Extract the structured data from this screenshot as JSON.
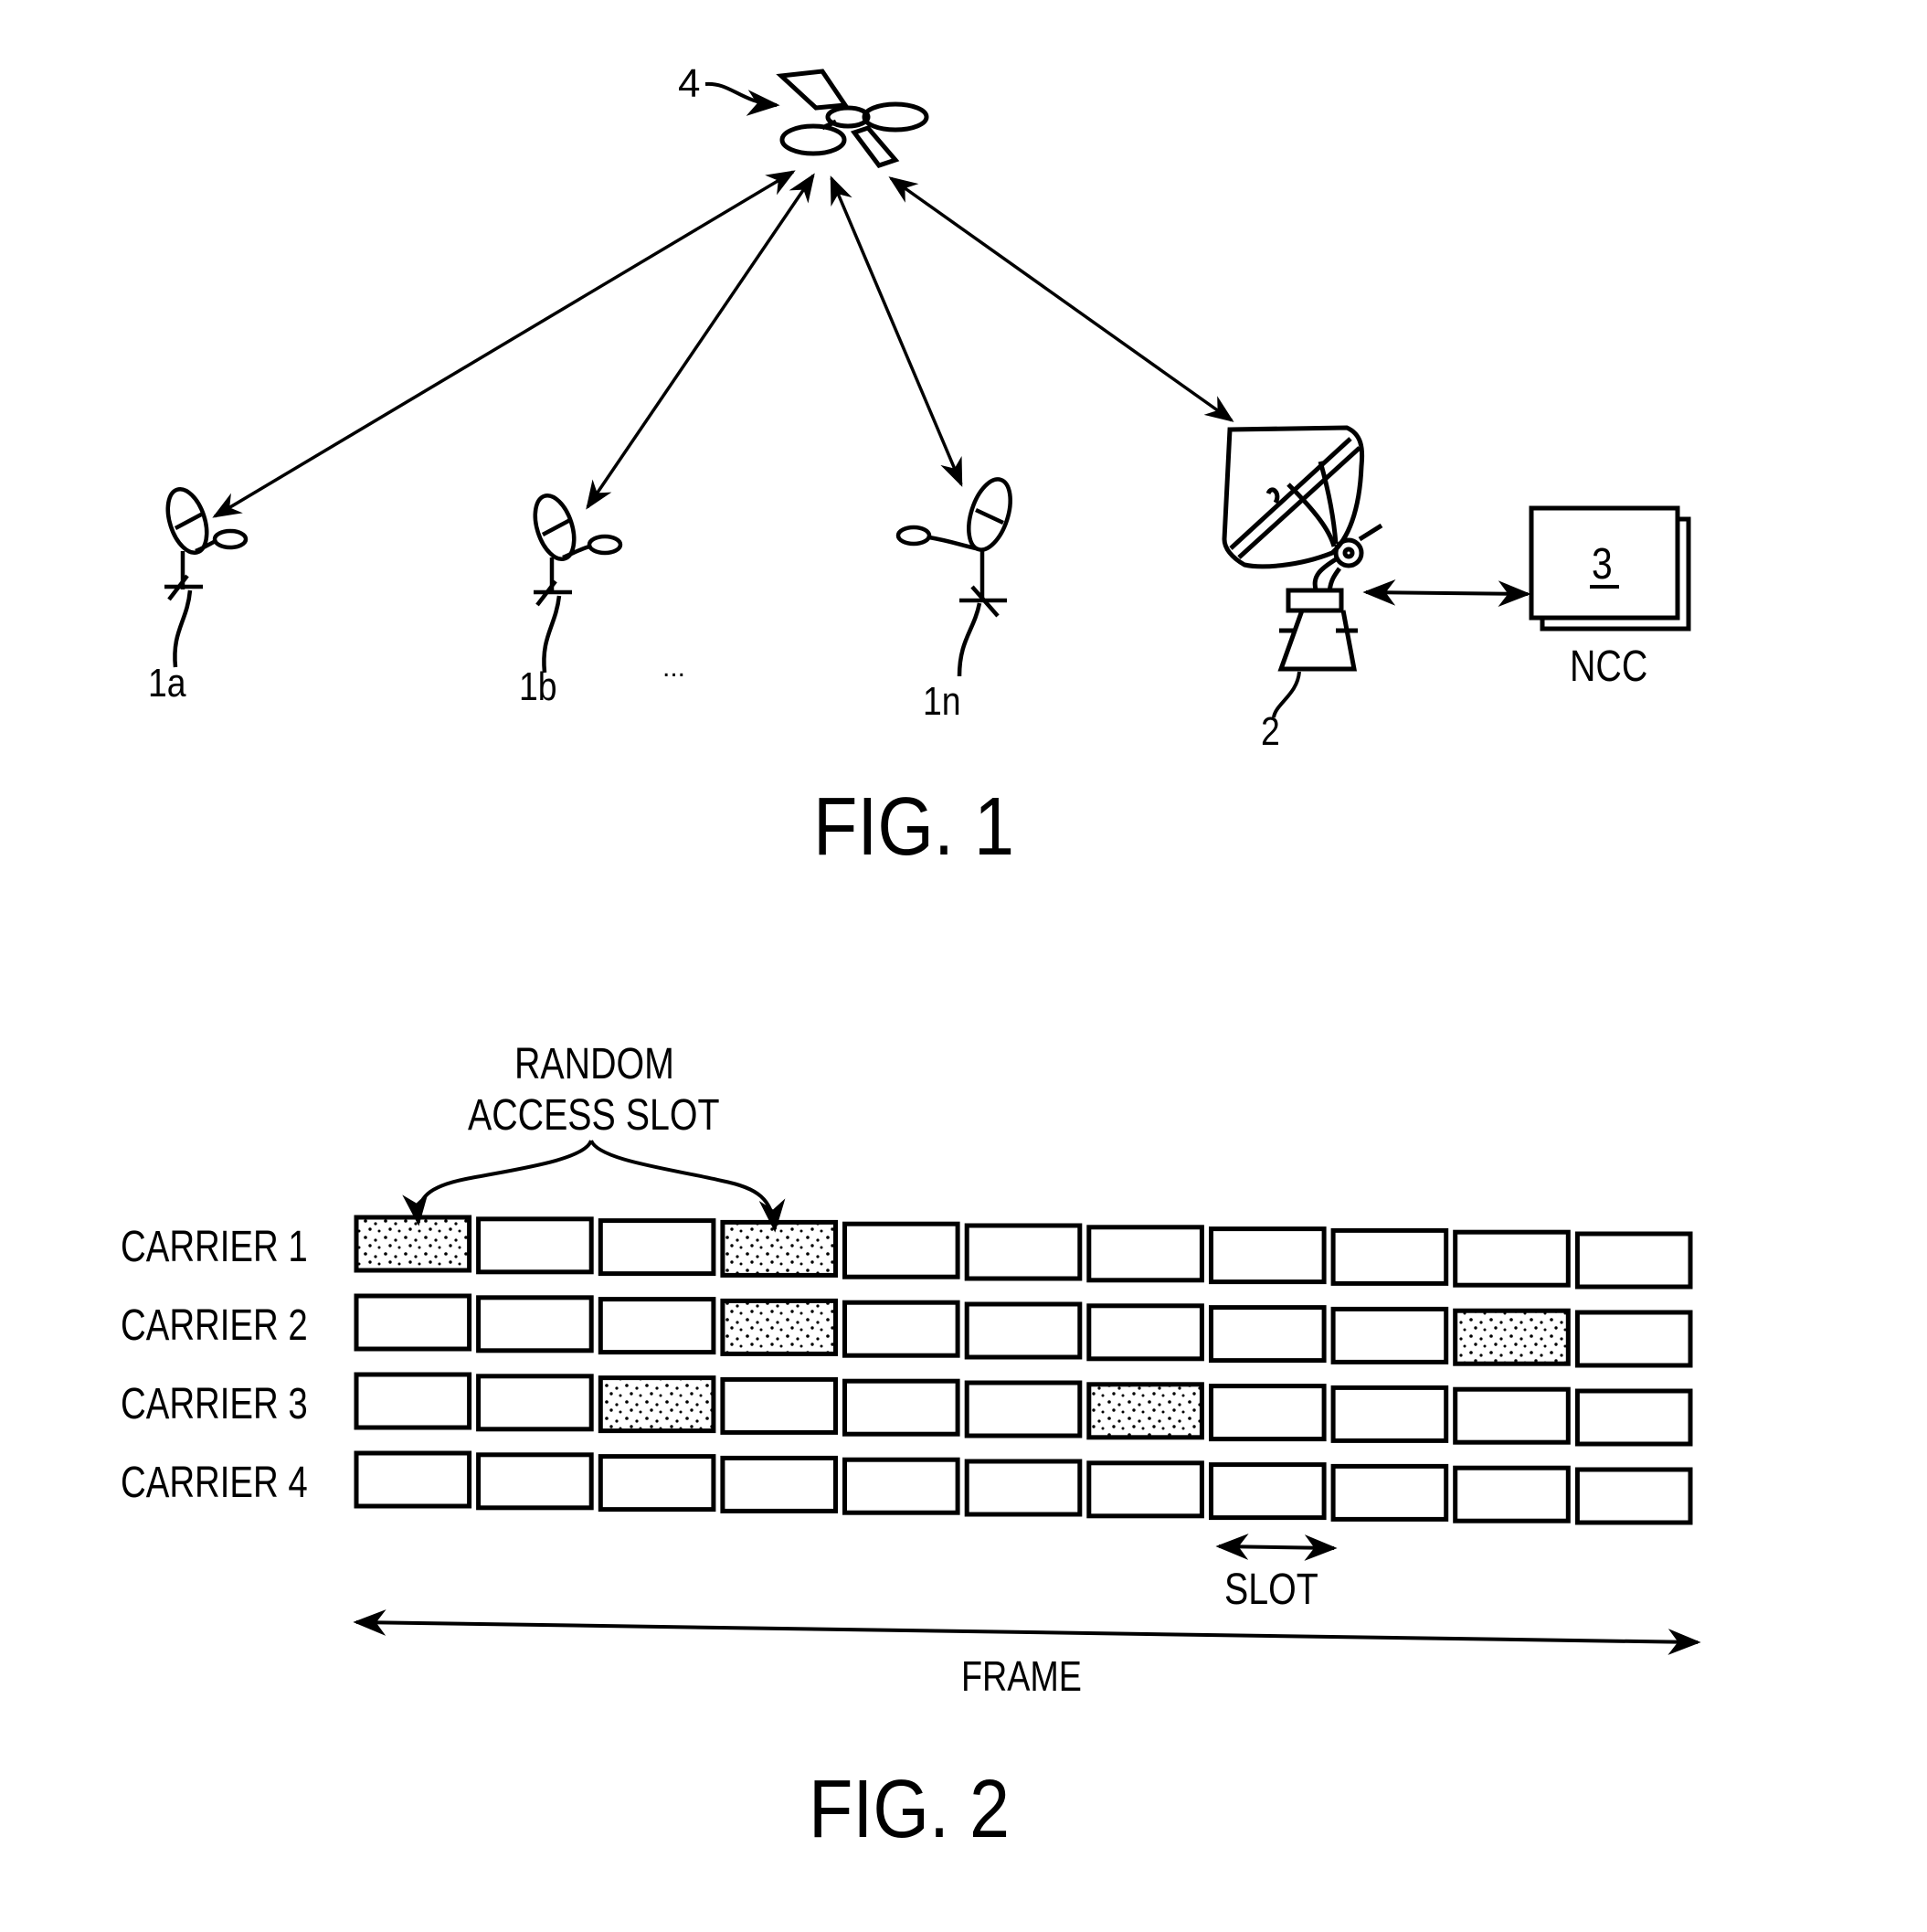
{
  "fig1": {
    "caption": "FIG. 1",
    "satellite": {
      "label": "4"
    },
    "terminals": [
      {
        "label": "1a"
      },
      {
        "label": "1b"
      },
      {
        "label": "1n"
      }
    ],
    "ellipsis": "...",
    "gateway": {
      "label": "2"
    },
    "ncc": {
      "number": "3",
      "label": "NCC"
    }
  },
  "fig2": {
    "caption": "FIG. 2",
    "callout": {
      "line1": "RANDOM",
      "line2": "ACCESS SLOT"
    },
    "slot_label": "SLOT",
    "frame_label": "FRAME",
    "slots_per_carrier": 11,
    "carriers": [
      {
        "label": "CARRIER 1",
        "random_access_slots": [
          1,
          4
        ]
      },
      {
        "label": "CARRIER 2",
        "random_access_slots": [
          4,
          10
        ]
      },
      {
        "label": "CARRIER 3",
        "random_access_slots": [
          3,
          7
        ]
      },
      {
        "label": "CARRIER 4",
        "random_access_slots": []
      }
    ]
  }
}
